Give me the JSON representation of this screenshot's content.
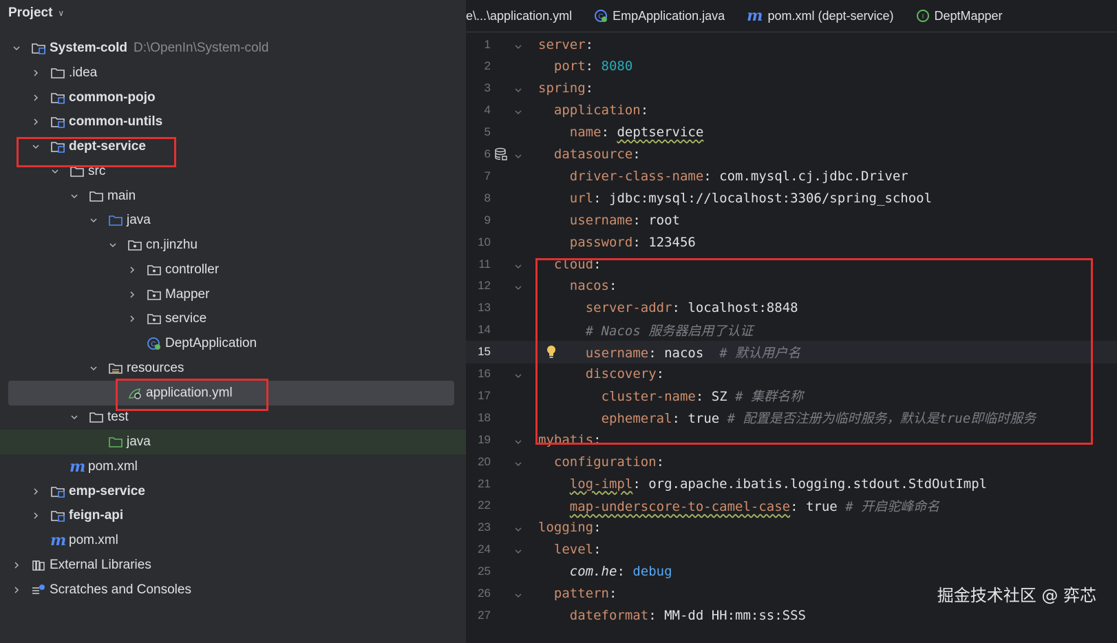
{
  "project_panel": {
    "title": "Project",
    "tree": [
      {
        "label": "System-cold",
        "hint": "D:\\OpenIn\\System-cold"
      },
      {
        "label": ".idea"
      },
      {
        "label": "common-pojo"
      },
      {
        "label": "common-untils"
      },
      {
        "label": "dept-service"
      },
      {
        "label": "src"
      },
      {
        "label": "main"
      },
      {
        "label": "java"
      },
      {
        "label": "cn.jinzhu"
      },
      {
        "label": "controller"
      },
      {
        "label": "Mapper"
      },
      {
        "label": "service"
      },
      {
        "label": "DeptApplication"
      },
      {
        "label": "resources"
      },
      {
        "label": "application.yml"
      },
      {
        "label": "test"
      },
      {
        "label": "java"
      },
      {
        "label": "pom.xml"
      },
      {
        "label": "emp-service"
      },
      {
        "label": "feign-api"
      },
      {
        "label": "pom.xml"
      },
      {
        "label": "External Libraries"
      },
      {
        "label": "Scratches and Consoles"
      }
    ]
  },
  "editor": {
    "tabs": [
      {
        "label": "e\\...\\application.yml",
        "icon": "yaml-icon"
      },
      {
        "label": "EmpApplication.java",
        "icon": "spring-class-icon"
      },
      {
        "label": "pom.xml (dept-service)",
        "icon": "maven-icon"
      },
      {
        "label": "DeptMapper",
        "icon": "interface-icon"
      }
    ],
    "current_line": 15,
    "lines": [
      {
        "num": "1",
        "key": "server",
        "sep": ":",
        "value": "",
        "comment": ""
      },
      {
        "num": "2",
        "key": "port",
        "sep": ": ",
        "value": "8080",
        "comment": ""
      },
      {
        "num": "3",
        "key": "spring",
        "sep": ":",
        "value": "",
        "comment": ""
      },
      {
        "num": "4",
        "key": "application",
        "sep": ":",
        "value": "",
        "comment": ""
      },
      {
        "num": "5",
        "key": "name",
        "sep": ": ",
        "value": "deptservice",
        "comment": ""
      },
      {
        "num": "6",
        "key": "datasource",
        "sep": ":",
        "value": "",
        "comment": ""
      },
      {
        "num": "7",
        "key": "driver-class-name",
        "sep": ": ",
        "value": "com.mysql.cj.jdbc.Driver",
        "comment": ""
      },
      {
        "num": "8",
        "key": "url",
        "sep": ": ",
        "value": "jdbc:mysql://localhost:3306/spring_school",
        "comment": ""
      },
      {
        "num": "9",
        "key": "username",
        "sep": ": ",
        "value": "root",
        "comment": ""
      },
      {
        "num": "10",
        "key": "password",
        "sep": ": ",
        "value": "123456",
        "comment": ""
      },
      {
        "num": "11",
        "key": "cloud",
        "sep": ":",
        "value": "",
        "comment": ""
      },
      {
        "num": "12",
        "key": "nacos",
        "sep": ":",
        "value": "",
        "comment": ""
      },
      {
        "num": "13",
        "key": "server-addr",
        "sep": ": ",
        "value": "localhost:8848",
        "comment": ""
      },
      {
        "num": "14",
        "key": "",
        "sep": "",
        "value": "",
        "comment": "# Nacos 服务器启用了认证"
      },
      {
        "num": "15",
        "key": "username",
        "sep": ": ",
        "value": "nacos",
        "comment": "# 默认用户名"
      },
      {
        "num": "16",
        "key": "discovery",
        "sep": ":",
        "value": "",
        "comment": ""
      },
      {
        "num": "17",
        "key": "cluster-name",
        "sep": ": ",
        "value": "SZ",
        "comment": "# 集群名称"
      },
      {
        "num": "18",
        "key": "ephemeral",
        "sep": ": ",
        "value": "true",
        "comment": "# 配置是否注册为临时服务，默认是true即临时服务"
      },
      {
        "num": "19",
        "key": "mybatis",
        "sep": ":",
        "value": "",
        "comment": ""
      },
      {
        "num": "20",
        "key": "configuration",
        "sep": ":",
        "value": "",
        "comment": ""
      },
      {
        "num": "21",
        "key": "log-impl",
        "sep": ": ",
        "value": "org.apache.ibatis.logging.stdout.StdOutImpl",
        "comment": ""
      },
      {
        "num": "22",
        "key": "map-underscore-to-camel-case",
        "sep": ": ",
        "value": "true",
        "comment": "# 开启驼峰命名"
      },
      {
        "num": "23",
        "key": "logging",
        "sep": ":",
        "value": "",
        "comment": ""
      },
      {
        "num": "24",
        "key": "level",
        "sep": ":",
        "value": "",
        "comment": ""
      },
      {
        "num": "25",
        "key": "com.he",
        "sep": ": ",
        "value": "debug",
        "comment": ""
      },
      {
        "num": "26",
        "key": "pattern",
        "sep": ":",
        "value": "",
        "comment": ""
      },
      {
        "num": "27",
        "key": "dateformat",
        "sep": ": ",
        "value": "MM-dd HH:mm:ss:SSS",
        "comment": ""
      }
    ]
  },
  "watermark": "掘金技术社区 @ 弈芯",
  "colors": {
    "highlight_box": "#e53030",
    "yaml_key": "#cf8e6d",
    "number": "#2aacb8",
    "comment": "#7a7e85",
    "keyword_value": "#56a8f5"
  }
}
